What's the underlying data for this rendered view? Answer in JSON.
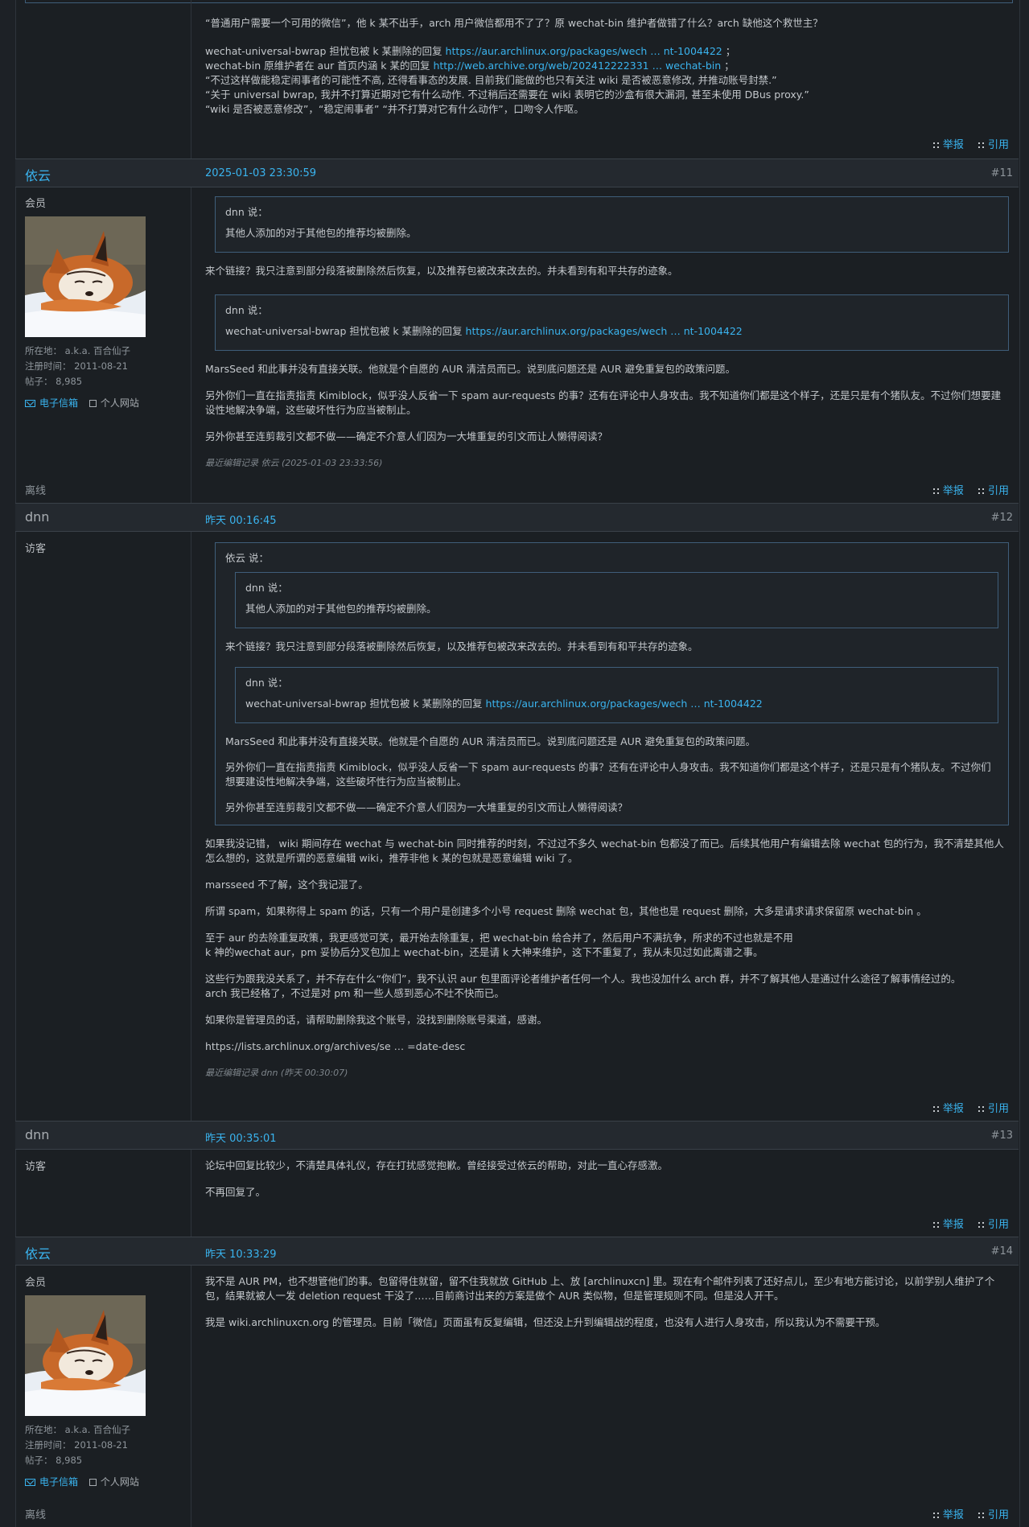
{
  "ui": {
    "report": "举报",
    "quote": "引用",
    "mail": "电子信箱",
    "website": "个人网站"
  },
  "top": {
    "lines": [
      "“普通用户需要一个可用的微信”，他 k 某不出手，arch 用户微信都用不了了？原 wechat-bin 维护者做错了什么？arch 缺他这个救世主？",
      "wechat-universal-bwrap 担忧包被 k 某删除的回复",
      "https://aur.archlinux.org/packages/wech … nt-1004422",
      "；",
      "wechat-bin 原维护者在 aur 首页内涵 k 某的回复",
      "http://web.archive.org/web/202412222331 … wechat-bin",
      "；",
      "“不过这样做能稳定闹事者的可能性不高, 还得看事态的发展. 目前我们能做的也只有关注 wiki 是否被恶意修改, 并推动账号封禁.”",
      "“关于 universal bwrap, 我并不打算近期对它有什么动作. 不过稍后还需要在 wiki 表明它的沙盒有很大漏洞, 甚至未使用 DBus proxy.”",
      "“wiki 是否被恶意修改”，“稳定闹事者” “并不打算对它有什么动作”，口吻令人作呕。"
    ]
  },
  "posts": [
    {
      "author": "依云",
      "time": "2025-01-03 23:30:59",
      "num": "#11",
      "role": "会员",
      "location": "所在地： a.k.a. 百合仙子",
      "reg": "注册时间： 2011-08-21",
      "posts": "帖子： 8,985",
      "q1_who": "dnn 说：",
      "q1_text": "其他人添加的对于其他包的推荐均被删除。",
      "p1": "来个链接？我只注意到部分段落被删除然后恢复，以及推荐包被改来改去的。并未看到有和平共存的迹象。",
      "q2_who": "dnn 说：",
      "q2_text": "wechat-universal-bwrap 担忧包被 k 某删除的回复",
      "q2_link": "https://aur.archlinux.org/packages/wech … nt-1004422",
      "p2": "MarsSeed 和此事并没有直接关联。他就是个自愿的 AUR 清洁员而已。说到底问题还是 AUR 避免重复包的政策问题。",
      "p3": "另外你们一直在指责指责 Kimiblock，似乎没人反省一下 spam aur-requests 的事？还有在评论中人身攻击。我不知道你们都是这个样子，还是只是有个猪队友。不过你们想要建设性地解决争端，这些破坏性行为应当被制止。",
      "p4": "另外你甚至连剪裁引文都不做——确定不介意人们因为一大堆重复的引文而让人懒得阅读？",
      "edit": "最近编辑记录 依云 (2025-01-03 23:33:56)",
      "status": "离线"
    },
    {
      "author": "dnn",
      "time": "昨天 00:16:45",
      "num": "#12",
      "role": "访客",
      "oq_who": "依云 说：",
      "iq1_who": "dnn 说：",
      "iq1_text": "其他人添加的对于其他包的推荐均被删除。",
      "oq_p1": "来个链接？我只注意到部分段落被删除然后恢复，以及推荐包被改来改去的。并未看到有和平共存的迹象。",
      "iq2_who": "dnn 说：",
      "iq2_text": "wechat-universal-bwrap 担忧包被 k 某删除的回复",
      "iq2_link": "https://aur.archlinux.org/packages/wech … nt-1004422",
      "oq_p2": "MarsSeed 和此事并没有直接关联。他就是个自愿的 AUR 清洁员而已。说到底问题还是 AUR 避免重复包的政策问题。",
      "oq_p3": "另外你们一直在指责指责 Kimiblock，似乎没人反省一下 spam aur-requests 的事？还有在评论中人身攻击。我不知道你们都是这个样子，还是只是有个猪队友。不过你们想要建设性地解决争端，这些破坏性行为应当被制止。",
      "oq_p4": "另外你甚至连剪裁引文都不做——确定不介意人们因为一大堆重复的引文而让人懒得阅读？",
      "p1": "如果我没记错， wiki 期间存在 wechat 与 wechat-bin 同时推荐的时刻，不过过不多久 wechat-bin 包都没了而已。后续其他用户有编辑去除 wechat 包的行为，我不清楚其他人怎么想的，这就是所谓的恶意编辑 wiki，推荐非他 k 某的包就是恶意编辑 wiki 了。",
      "p2": "marsseed 不了解，这个我记混了。",
      "p3": "所谓 spam，如果称得上 spam 的话，只有一个用户是创建多个小号 request 删除 wechat 包，其他也是 request 删除，大多是请求请求保留原 wechat-bin 。",
      "p4a": "至于 aur 的去除重复政策，我更感觉可笑，最开始去除重复，把 wechat-bin 给合并了，然后用户不满抗争，所求的不过也就是不用",
      "p4b": "k 神的wechat aur，pm 妥协后分叉包加上 wechat-bin，还是请 k 大神来维护，这下不重复了，我从未见过如此离谱之事。",
      "p5a": "这些行为跟我没关系了，并不存在什么“你们”，我不认识 aur 包里面评论者维护者任何一个人。我也没加什么 arch 群，并不了解其他人是通过什么途径了解事情经过的。",
      "p5b": "arch 我已经格了，不过是对 pm 和一些人感到恶心不吐不快而已。",
      "p6": "如果你是管理员的话，请帮助删除我这个账号，没找到删除账号渠道，感谢。",
      "p7": "https://lists.archlinux.org/archives/se … =date-desc",
      "edit": "最近编辑记录 dnn (昨天 00:30:07)"
    },
    {
      "author": "dnn",
      "time": "昨天 00:35:01",
      "num": "#13",
      "role": "访客",
      "p1": "论坛中回复比较少，不清楚具体礼仪，存在打扰感觉抱歉。曾经接受过依云的帮助，对此一直心存感激。",
      "p2": "不再回复了。"
    },
    {
      "author": "依云",
      "time": "昨天 10:33:29",
      "num": "#14",
      "role": "会员",
      "location": "所在地： a.k.a. 百合仙子",
      "reg": "注册时间： 2011-08-21",
      "posts": "帖子： 8,985",
      "p1": "我不是 AUR PM，也不想管他们的事。包留得住就留，留不住我就放 GitHub 上、放 [archlinuxcn] 里。现在有个邮件列表了还好点儿，至少有地方能讨论，以前学别人维护了个包，结果就被人一发 deletion request 干没了……目前商讨出来的方案是做个 AUR 类似物，但是管理规则不同。但是没人开干。",
      "p2": "我是 wiki.archlinuxcn.org 的管理员。目前「微信」页面虽有反复编辑，但还没上升到编辑战的程度，也没有人进行人身攻击，所以我认为不需要干预。",
      "status": "离线"
    }
  ]
}
